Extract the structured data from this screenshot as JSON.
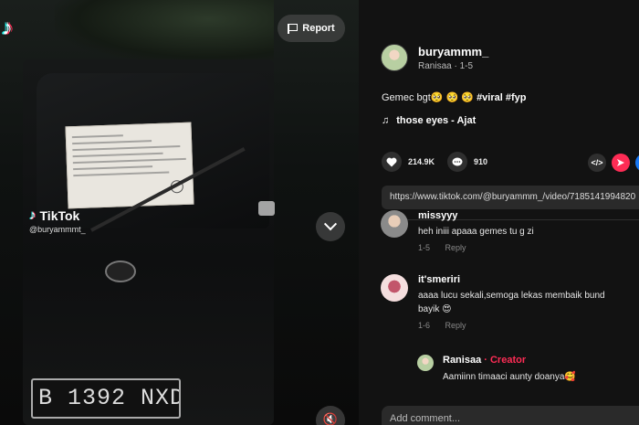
{
  "video": {
    "watermark_brand": "TikTok",
    "watermark_user": "@buryammmt_",
    "plate_text": "B 1392 NXD",
    "report_label": "Report",
    "mute_icon": "🔇"
  },
  "author": {
    "username": "buryammm_",
    "display": "Ranisaa · 1-5"
  },
  "caption": {
    "text": "Gemec bgt🥺 🥺 🥺 ",
    "hashtags": "#viral #fyp"
  },
  "music": {
    "note_icon": "♫",
    "title": "those eyes - Ajat"
  },
  "stats": {
    "likes": "214.9K",
    "comments": "910"
  },
  "share": {
    "embed_label": "</>",
    "url": "https://www.tiktok.com/@buryammm_/video/7185141994820"
  },
  "comments": [
    {
      "name": "missyyy",
      "text": "heh iniii apaaa gemes tu g zi",
      "date": "1-5",
      "reply": "Reply"
    },
    {
      "name": "it'smeriri",
      "text": "aaaa lucu sekali,semoga lekas membaik bund",
      "text2": "bayik 😍",
      "date": "1-6",
      "reply": "Reply"
    },
    {
      "name": "Ranisaa",
      "badge": "· Creator",
      "text": "Aamiinn timaaci aunty doanya🥰"
    }
  ],
  "comment_placeholder": "Add comment...",
  "colors": {
    "accent": "#FE2C55",
    "bg": "#121212"
  }
}
